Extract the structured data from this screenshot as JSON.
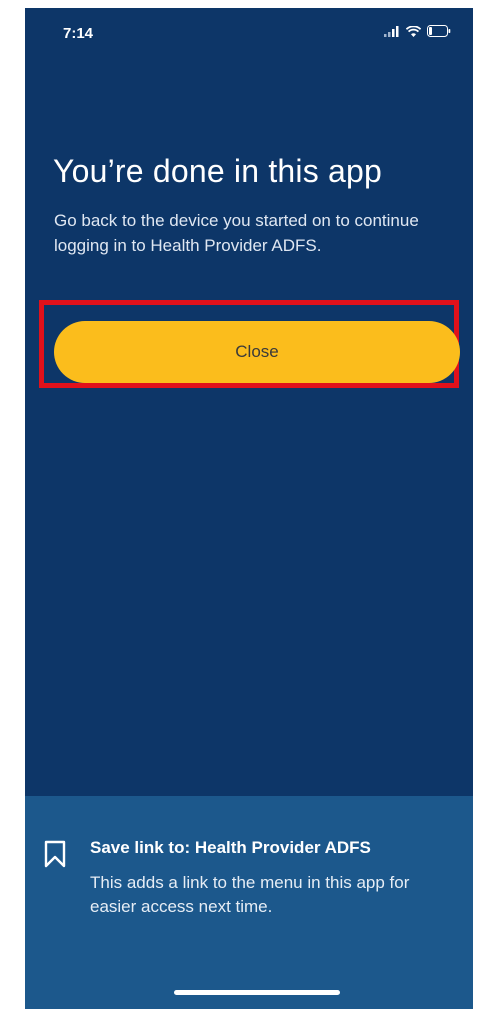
{
  "status_bar": {
    "time": "7:14",
    "icons": [
      "cellular-signal-icon",
      "wifi-icon",
      "battery-icon"
    ]
  },
  "main": {
    "title": "You’re done in this app",
    "subtitle": "Go back to the device you started on to continue logging in to Health Provider ADFS.",
    "close_label": "Close"
  },
  "save_link": {
    "icon": "bookmark-icon",
    "title": "Save link to: Health Provider ADFS",
    "description": "This adds a link to the menu in this app for easier access next time."
  },
  "colors": {
    "background": "#0d3668",
    "button": "#fbbd1c",
    "panel": "#1c588c",
    "highlight": "#e0111b"
  }
}
